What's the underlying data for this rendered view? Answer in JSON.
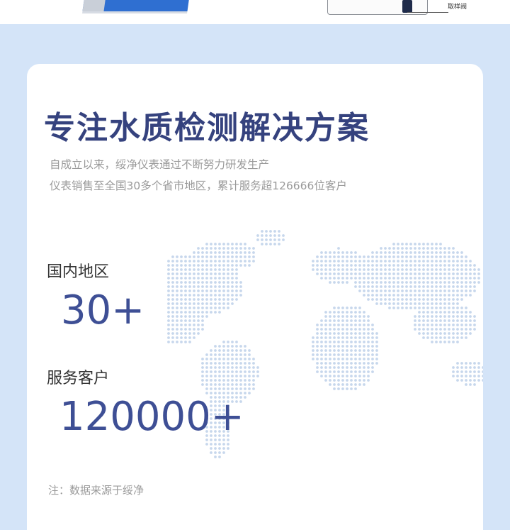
{
  "top_strip": {
    "diagram_label": "取样阀"
  },
  "card": {
    "title": "专注水质检测解决方案",
    "intro_line_1": "自成立以来，绥净仪表通过不断努力研发生产",
    "intro_line_2": "仪表销售至全国30多个省市地区，累计服务超126666位客户",
    "stats": [
      {
        "label": "国内地区",
        "value": "30+"
      },
      {
        "label": "服务客户",
        "value": "120000+"
      }
    ],
    "note": "注：数据来源于绥净"
  },
  "colors": {
    "title": "#35427e",
    "stat_value": "#3e4f95",
    "panel_bg": "#d4e4f8",
    "map_dots": "#c7d7ec"
  }
}
